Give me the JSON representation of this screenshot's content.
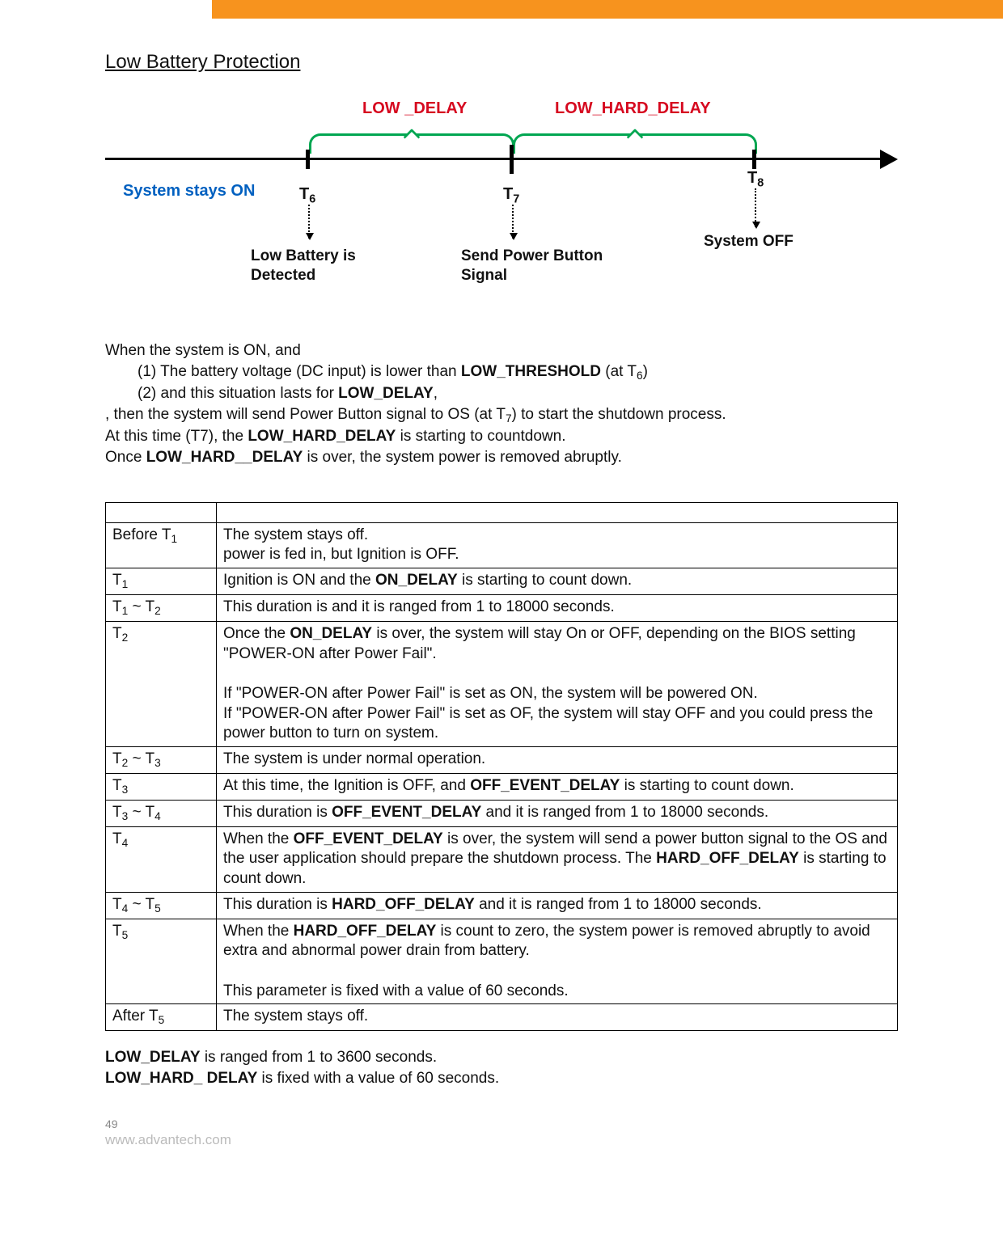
{
  "section_title": "Low Battery Protection",
  "diagram": {
    "low_delay": "LOW _DELAY",
    "low_hard_delay": "LOW_HARD_DELAY",
    "system_on": "System stays ON",
    "t6": "T",
    "t6_sub": "6",
    "t7": "T",
    "t7_sub": "7",
    "t8": "T",
    "t8_sub": "8",
    "ev6": "Low Battery is Detected",
    "ev7": "Send Power Button Signal",
    "ev8": "System OFF"
  },
  "para": {
    "intro": "When the system is ON, and",
    "p1_pre": "(1) The battery voltage (DC input) is lower than ",
    "p1_bold": "LOW_THRESHOLD",
    "p1_post": " (at T",
    "p1_sub": "6",
    "p1_end": ")",
    "p2_pre": "(2) and this situation lasts for ",
    "p2_bold": "LOW_DELAY",
    "p2_post": ",",
    "after1_pre": ", then the system will send Power Button signal to OS (at T",
    "after1_sub": "7",
    "after1_post": ") to start the shutdown process.",
    "after2_pre": "At this time (T7), the ",
    "after2_bold": "LOW_HARD_DELAY",
    "after2_post": " is starting to countdown.",
    "after3_pre": "Once ",
    "after3_bold": "LOW_HARD__DELAY",
    "after3_post": " is over, the system power is removed abruptly."
  },
  "rows": [
    {
      "t_pre": "Before    T",
      "t_sub": "1",
      "html": "The system stays off.<br>power is fed in, but Ignition is OFF."
    },
    {
      "t_pre": "T",
      "t_sub": "1",
      "html": "Ignition is ON and the <b>ON_DELAY</b> is starting to count down."
    },
    {
      "t_pre": "T",
      "t_sub": "1",
      "t_mid": " ~ T",
      "t_sub2": "2",
      "html": "This duration is and it is ranged from 1 to 18000 seconds."
    },
    {
      "t_pre": "T",
      "t_sub": "2",
      "html": "Once the <b>ON_DELAY</b> is over, the system will stay On or OFF, depending on the BIOS setting \"POWER-ON after Power Fail\".<br><br>If \"POWER-ON after Power Fail\" is set as ON, the system will be powered ON.<br>If \"POWER-ON after Power Fail\" is set as OF, the system will stay OFF and you could press the power button to turn on system."
    },
    {
      "t_pre": "T",
      "t_sub": "2",
      "t_mid": " ~ T",
      "t_sub2": "3",
      "html": "The system is under normal operation."
    },
    {
      "t_pre": "T",
      "t_sub": "3",
      "html": "At this time, the Ignition is OFF, and <b>OFF_EVENT_DELAY</b> is starting to count down."
    },
    {
      "t_pre": "T",
      "t_sub": "3",
      "t_mid": " ~ T",
      "t_sub2": "4",
      "html": "This duration is <b>OFF_EVENT_DELAY</b> and it is ranged from 1 to 18000 seconds."
    },
    {
      "t_pre": "T",
      "t_sub": "4",
      "html": "When the <b>OFF_EVENT_DELAY</b> is over, the system will send a power button signal to the OS and the user application should prepare the shutdown process. The <b>HARD_OFF_DELAY</b> is starting to count down."
    },
    {
      "t_pre": "T",
      "t_sub": "4",
      "t_mid": " ~ T",
      "t_sub2": "5",
      "html": "This duration is <b>HARD_OFF_DELAY</b> and it is ranged from 1 to 18000 seconds."
    },
    {
      "t_pre": "T",
      "t_sub": "5",
      "html": "When the <b>HARD_OFF_DELAY</b> is count to zero, the system power is removed abruptly to avoid extra and abnormal power drain from battery.<br><br>This parameter is fixed with a value of 60 seconds."
    },
    {
      "t_pre": "After T",
      "t_sub": "5",
      "html": "The system stays off."
    }
  ],
  "notes": {
    "n1_bold": "LOW_DELAY",
    "n1_rest": " is ranged from 1 to 3600 seconds.",
    "n2_bold": "LOW_HARD_ DELAY",
    "n2_rest": " is fixed with a value of 60 seconds."
  },
  "footer": {
    "page_no": "49",
    "url": "www.advantech.com"
  }
}
